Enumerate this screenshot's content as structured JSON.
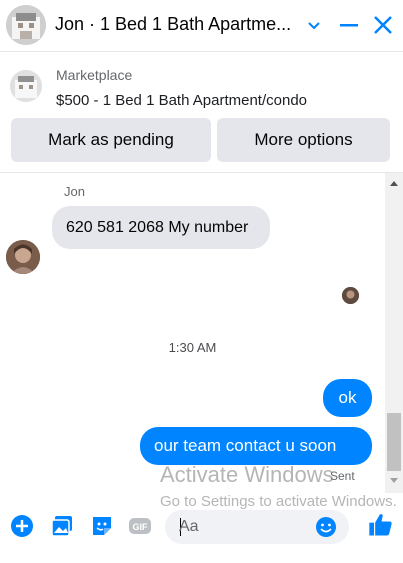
{
  "header": {
    "title": "Jon · 1 Bed 1 Bath Apartme...",
    "accent_color": "#0084ff"
  },
  "listing": {
    "source": "Marketplace",
    "title": "$500 - 1 Bed 1 Bath Apartment/condo"
  },
  "actions": {
    "mark_pending": "Mark as pending",
    "more_options": "More options"
  },
  "messages": {
    "sender_name": "Jon",
    "incoming": "620 581 2068 My number",
    "timestamp": "1:30 AM",
    "outgoing": [
      "ok",
      "our team contact u soon"
    ],
    "status": "Sent"
  },
  "watermark": {
    "line1": "Activate Windows",
    "line2": "Go to Settings to activate Windows."
  },
  "composer": {
    "placeholder": "Aa",
    "icons": [
      "plus-circle-icon",
      "photo-icon",
      "sticker-icon",
      "gif-icon",
      "emoji-icon",
      "thumbs-up-icon"
    ]
  }
}
